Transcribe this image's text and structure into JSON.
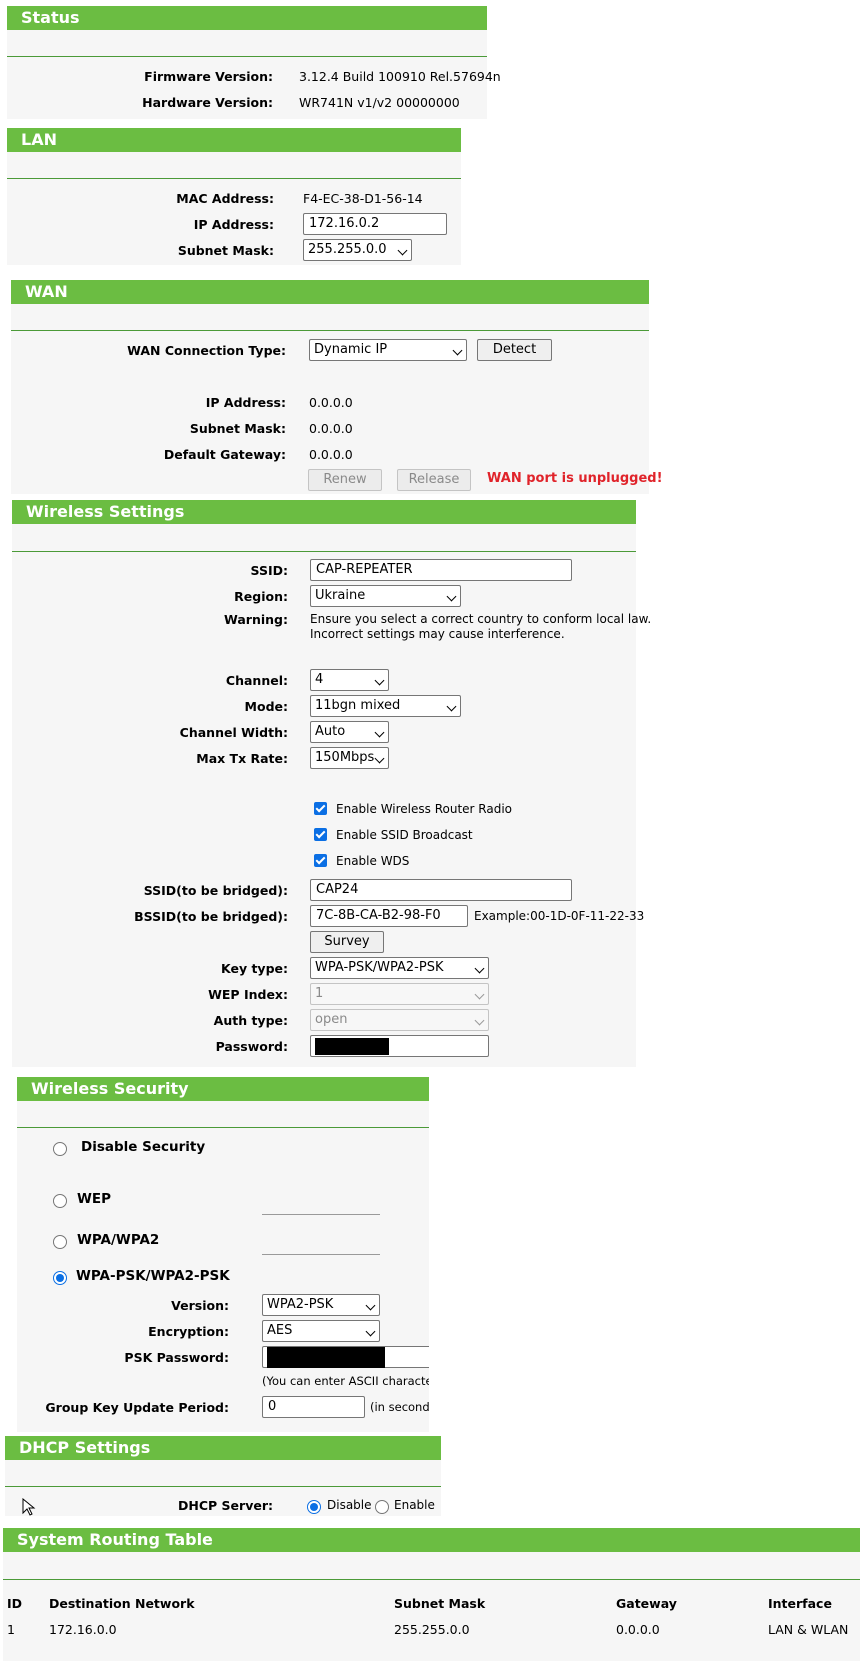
{
  "status": {
    "title": "Status",
    "firmware_label": "Firmware Version:",
    "firmware_value": "3.12.4 Build 100910 Rel.57694n",
    "hardware_label": "Hardware Version:",
    "hardware_value": "WR741N v1/v2 00000000"
  },
  "lan": {
    "title": "LAN",
    "mac_label": "MAC Address:",
    "mac_value": "F4-EC-38-D1-56-14",
    "ip_label": "IP Address:",
    "ip_value": "172.16.0.2",
    "mask_label": "Subnet Mask:",
    "mask_value": "255.255.0.0"
  },
  "wan": {
    "title": "WAN",
    "conn_type_label": "WAN Connection Type:",
    "conn_type_value": "Dynamic IP",
    "detect_label": "Detect",
    "ip_label": "IP Address:",
    "ip_value": "0.0.0.0",
    "mask_label": "Subnet Mask:",
    "mask_value": "0.0.0.0",
    "gateway_label": "Default Gateway:",
    "gateway_value": "0.0.0.0",
    "renew_label": "Renew",
    "release_label": "Release",
    "warning": "WAN port is unplugged!",
    "warning_color": "#e0232a"
  },
  "wireless": {
    "title": "Wireless Settings",
    "ssid_label": "SSID:",
    "ssid_value": "CAP-REPEATER",
    "region_label": "Region:",
    "region_value": "Ukraine",
    "warning_label": "Warning:",
    "warning_line1": "Ensure you select a correct country to conform local law.",
    "warning_line2": "Incorrect settings may cause interference.",
    "channel_label": "Channel:",
    "channel_value": "4",
    "mode_label": "Mode:",
    "mode_value": "11bgn mixed",
    "width_label": "Channel Width:",
    "width_value": "Auto",
    "txrate_label": "Max Tx Rate:",
    "txrate_value": "150Mbps",
    "radio_label": "Enable Wireless Router Radio",
    "ssid_broadcast_label": "Enable SSID Broadcast",
    "wds_label": "Enable WDS",
    "bridged_ssid_label": "SSID(to be bridged):",
    "bridged_ssid_value": "CAP24",
    "bridged_bssid_label": "BSSID(to be bridged):",
    "bridged_bssid_value": "7C-8B-CA-B2-98-F0",
    "bssid_example": "Example:00-1D-0F-11-22-33",
    "survey_label": "Survey",
    "key_type_label": "Key type:",
    "key_type_value": "WPA-PSK/WPA2-PSK",
    "wep_index_label": "WEP Index:",
    "wep_index_value": "1",
    "auth_type_label": "Auth type:",
    "auth_type_value": "open",
    "password_label": "Password:"
  },
  "security": {
    "title": "Wireless Security",
    "disable_label": "Disable Security",
    "wep_label": "WEP",
    "wpa_label": "WPA/WPA2",
    "wpapsk_label": "WPA-PSK/WPA2-PSK",
    "version_label": "Version:",
    "version_value": "WPA2-PSK",
    "encryption_label": "Encryption:",
    "encryption_value": "AES",
    "psk_label": "PSK Password:",
    "psk_hint": "(You can enter ASCII characters",
    "group_key_label": "Group Key Update Period:",
    "group_key_value": "0",
    "group_key_unit": "(in second,"
  },
  "dhcp": {
    "title": "DHCP Settings",
    "server_label": "DHCP Server:",
    "disable_label": "Disable",
    "enable_label": "Enable"
  },
  "routing": {
    "title": "System Routing Table",
    "headers": [
      "ID",
      "Destination Network",
      "Subnet Mask",
      "Gateway",
      "Interface"
    ],
    "rows": [
      [
        "1",
        "172.16.0.0",
        "255.255.0.0",
        "0.0.0.0",
        "LAN & WLAN"
      ]
    ]
  },
  "colors": {
    "header_green": "#6bbd42",
    "accent_blue": "#0b6fe4"
  }
}
